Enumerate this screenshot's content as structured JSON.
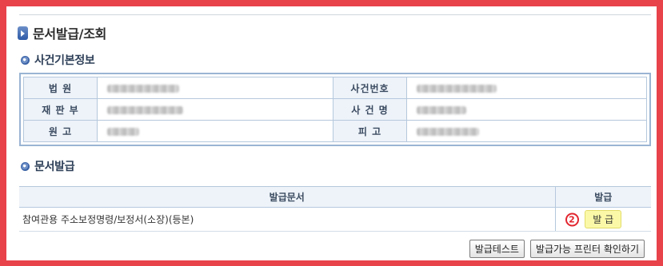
{
  "page": {
    "title": "문서발급/조회"
  },
  "case_info": {
    "section_title": "사건기본정보",
    "rows": [
      {
        "label1": "법 원",
        "label2": "사건번호"
      },
      {
        "label1": "재 판 부",
        "label2": "사 건 명"
      },
      {
        "label1": "원 고",
        "label2": "피 고"
      }
    ]
  },
  "issue": {
    "section_title": "문서발급",
    "headers": {
      "document": "발급문서",
      "issue": "발급"
    },
    "rows": [
      {
        "document": "참여관용 주소보정명령/보정서(소장)(등본)",
        "button": "발 급",
        "marker": "2"
      }
    ]
  },
  "buttons": {
    "test": "발급테스트",
    "printer_check": "발급가능 프린터 확인하기"
  },
  "colors": {
    "frame": "#e8434b",
    "accent": "#3a62a6",
    "issue_button": "#fbf9a8",
    "marker": "#e2262f"
  }
}
